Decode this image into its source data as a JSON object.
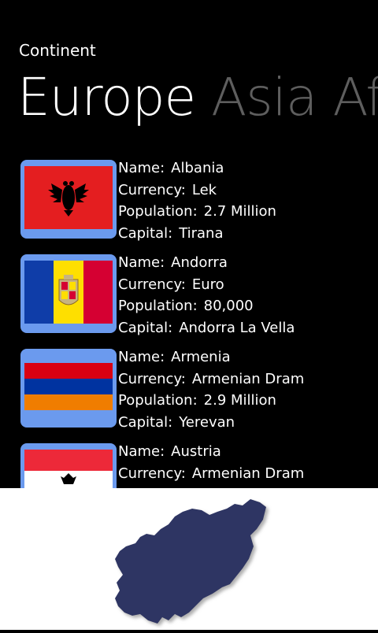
{
  "app": {
    "title": "Continent"
  },
  "pivot": {
    "items": [
      "Europe",
      "Asia",
      "Af"
    ]
  },
  "labels": {
    "name": "Name:",
    "currency": "Currency:",
    "population": "Population:",
    "capital": "Capital:"
  },
  "countries": [
    {
      "name": "Albania",
      "currency": "Lek",
      "population": "2.7 Million",
      "capital": "Tirana"
    },
    {
      "name": "Andorra",
      "currency": "Euro",
      "population": "80,000",
      "capital": "Andorra La Vella"
    },
    {
      "name": "Armenia",
      "currency": "Armenian Dram",
      "population": "2.9 Million",
      "capital": "Yerevan"
    },
    {
      "name": "Austria",
      "currency": "Armenian Dram"
    }
  ],
  "colors": {
    "accent": "#6b9aee",
    "map": "#2e3563",
    "inactive_pivot": "#5e5e5e"
  },
  "icons": {
    "map": "europe-map-icon"
  }
}
